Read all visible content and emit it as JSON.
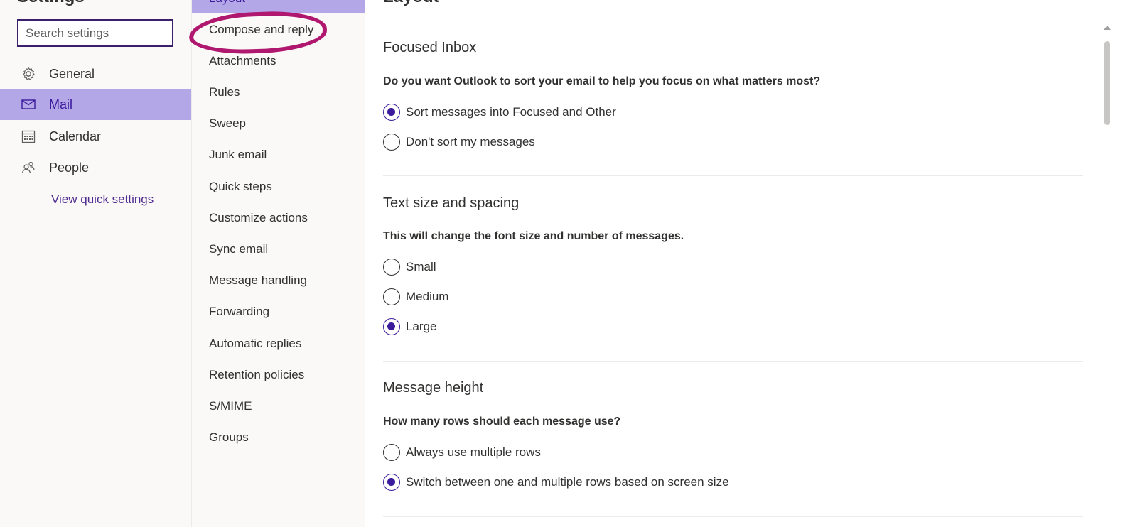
{
  "left_nav": {
    "title": "Settings",
    "search_placeholder": "Search settings",
    "items": [
      {
        "label": "General",
        "icon": "gear-icon"
      },
      {
        "label": "Mail",
        "icon": "mail-icon"
      },
      {
        "label": "Calendar",
        "icon": "calendar-icon"
      },
      {
        "label": "People",
        "icon": "people-icon"
      }
    ],
    "selected": "Mail",
    "quick_settings_link": "View quick settings"
  },
  "mid_nav": {
    "selected_item": "Layout",
    "items": [
      "Compose and reply",
      "Attachments",
      "Rules",
      "Sweep",
      "Junk email",
      "Quick steps",
      "Customize actions",
      "Sync email",
      "Message handling",
      "Forwarding",
      "Automatic replies",
      "Retention policies",
      "S/MIME",
      "Groups"
    ]
  },
  "main": {
    "title": "Layout",
    "sections": [
      {
        "title": "Focused Inbox",
        "question": "Do you want Outlook to sort your email to help you focus on what matters most?",
        "options": [
          "Sort messages into Focused and Other",
          "Don't sort my messages"
        ],
        "selected": 0
      },
      {
        "title": "Text size and spacing",
        "question": "This will change the font size and number of messages.",
        "options": [
          "Small",
          "Medium",
          "Large"
        ],
        "selected": 2
      },
      {
        "title": "Message height",
        "question": "How many rows should each message use?",
        "options": [
          "Always use multiple rows",
          "Switch between one and multiple rows based on screen size"
        ],
        "selected": 1
      }
    ]
  },
  "colors": {
    "accent": "#3b1a9c",
    "selected_bg": "#b4a7e8",
    "annotation": "#b0176e"
  }
}
